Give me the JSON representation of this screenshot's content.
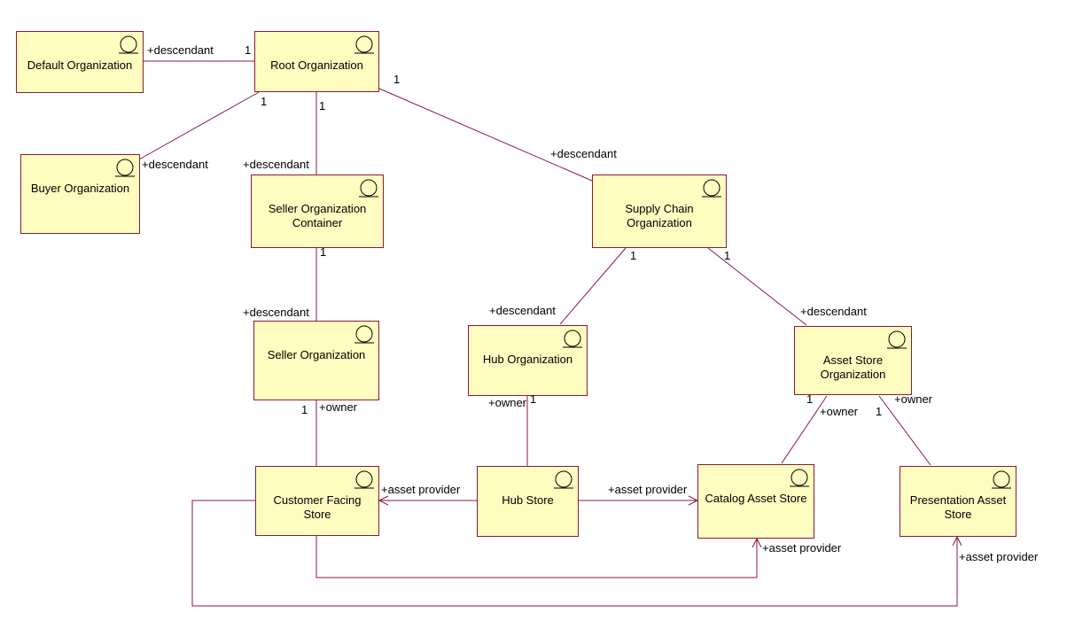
{
  "diagram": {
    "type": "UML object diagram",
    "line_color": "#8b1a3a",
    "box_fill": "#fffcc0",
    "objects": [
      {
        "id": "default",
        "name": "Default Organization",
        "icon": "entity-icon"
      },
      {
        "id": "root",
        "name": "Root Organization",
        "icon": "entity-icon"
      },
      {
        "id": "buyer",
        "name": "Buyer Organization",
        "icon": "entity-icon"
      },
      {
        "id": "seller-container",
        "name": "Seller Organization Container",
        "lines": [
          "Seller Organization",
          "Container"
        ],
        "icon": "entity-icon"
      },
      {
        "id": "supply-chain",
        "name": "Supply Chain Organization",
        "lines": [
          "Supply Chain",
          "Organization"
        ],
        "icon": "entity-icon"
      },
      {
        "id": "seller",
        "name": "Seller Organization",
        "icon": "entity-icon"
      },
      {
        "id": "hub-org",
        "name": "Hub Organization",
        "icon": "entity-icon"
      },
      {
        "id": "asset-store-org",
        "name": "Asset Store Organization",
        "lines": [
          "Asset Store",
          "Organization"
        ],
        "icon": "entity-icon"
      },
      {
        "id": "customer-facing",
        "name": "Customer Facing Store",
        "lines": [
          "Customer Facing",
          "Store"
        ],
        "icon": "entity-icon"
      },
      {
        "id": "hub-store",
        "name": "Hub Store",
        "icon": "entity-icon"
      },
      {
        "id": "catalog-asset",
        "name": "Catalog Asset Store",
        "icon": "entity-icon"
      },
      {
        "id": "presentation-asset",
        "name": "Presentation Asset Store",
        "lines": [
          "Presentation Asset",
          "Store"
        ],
        "icon": "entity-icon"
      }
    ],
    "associations": [
      {
        "from": "root",
        "to": "default",
        "from_mult": "1",
        "to_role": "+descendant"
      },
      {
        "from": "root",
        "to": "buyer",
        "from_mult": "1",
        "to_role": "+descendant"
      },
      {
        "from": "root",
        "to": "seller-container",
        "from_mult": "1",
        "to_role": "+descendant"
      },
      {
        "from": "root",
        "to": "supply-chain",
        "from_mult": "1",
        "to_role": "+descendant"
      },
      {
        "from": "seller-container",
        "to": "seller",
        "from_mult": "1",
        "to_role": "+descendant"
      },
      {
        "from": "supply-chain",
        "to": "hub-org",
        "from_mult": "1",
        "to_role": "+descendant"
      },
      {
        "from": "supply-chain",
        "to": "asset-store-org",
        "from_mult": "1",
        "to_role": "+descendant"
      },
      {
        "from": "seller",
        "to": "customer-facing",
        "from_mult": "1",
        "from_role": "+owner"
      },
      {
        "from": "hub-org",
        "to": "hub-store",
        "from_mult": "1",
        "from_role": "+owner"
      },
      {
        "from": "asset-store-org",
        "to": "catalog-asset",
        "from_mult": "1",
        "from_role": "+owner"
      },
      {
        "from": "asset-store-org",
        "to": "presentation-asset",
        "from_mult": "1",
        "from_role": "+owner"
      },
      {
        "from": "hub-store",
        "to": "customer-facing",
        "to_role": "+asset provider",
        "navigable": true
      },
      {
        "from": "hub-store",
        "to": "catalog-asset",
        "to_role": "+asset provider",
        "navigable": true
      },
      {
        "from": "customer-facing",
        "to": "catalog-asset",
        "to_role": "+asset provider",
        "navigable": true
      },
      {
        "from": "customer-facing",
        "to": "presentation-asset",
        "to_role": "+asset provider",
        "navigable": true
      }
    ],
    "labels": {
      "descendant": "+descendant",
      "owner": "+owner",
      "asset_provider": "+asset provider",
      "one": "1"
    }
  }
}
